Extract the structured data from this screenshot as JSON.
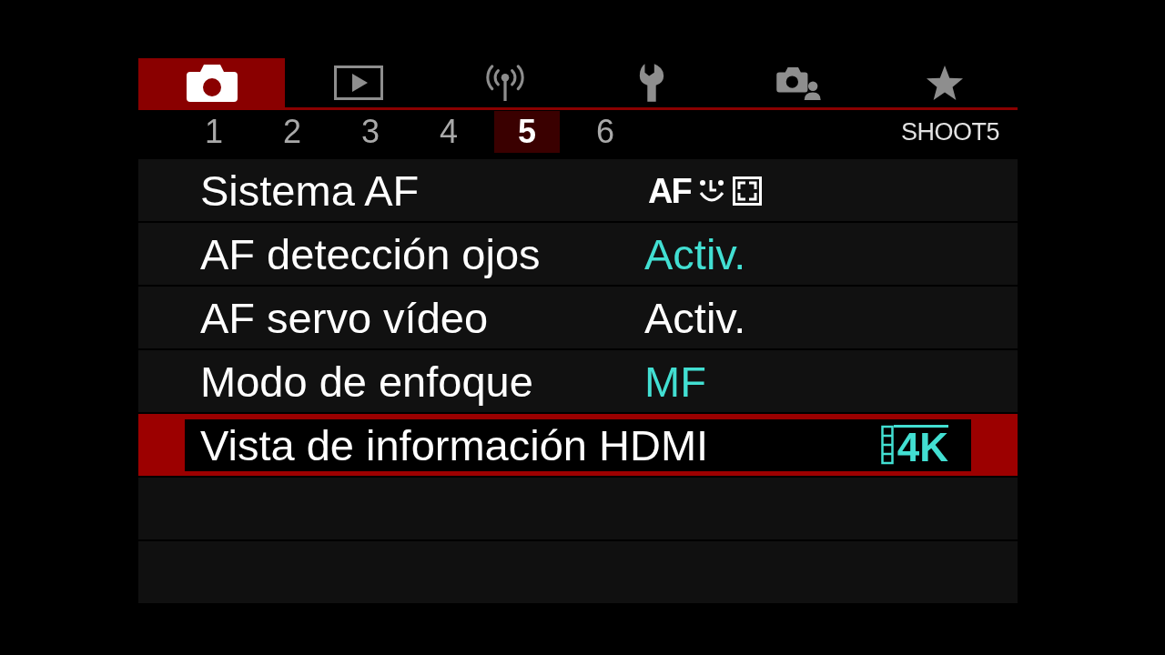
{
  "tabs": [
    {
      "selected": true
    },
    {
      "selected": false
    },
    {
      "selected": false
    },
    {
      "selected": false
    },
    {
      "selected": false
    },
    {
      "selected": false
    }
  ],
  "subtabs": [
    {
      "label": "1",
      "selected": false
    },
    {
      "label": "2",
      "selected": false
    },
    {
      "label": "3",
      "selected": false
    },
    {
      "label": "4",
      "selected": false
    },
    {
      "label": "5",
      "selected": true
    },
    {
      "label": "6",
      "selected": false
    }
  ],
  "page_label": "SHOOT5",
  "rows": [
    {
      "label": "Sistema AF",
      "kind": "af-method",
      "value": "AF",
      "color": "#ffffff",
      "selected": false
    },
    {
      "label": "AF detección ojos",
      "kind": "text",
      "value": "Activ.",
      "color": "#42dfd2",
      "selected": false
    },
    {
      "label": "AF servo vídeo",
      "kind": "text",
      "value": "Activ.",
      "color": "#ffffff",
      "selected": false
    },
    {
      "label": "Modo de enfoque",
      "kind": "text",
      "value": "MF",
      "color": "#42dfd2",
      "selected": false
    },
    {
      "label": "Vista de información HDMI",
      "kind": "movie-4k",
      "value": "4K",
      "color": "#42dfd2",
      "selected": true
    }
  ]
}
